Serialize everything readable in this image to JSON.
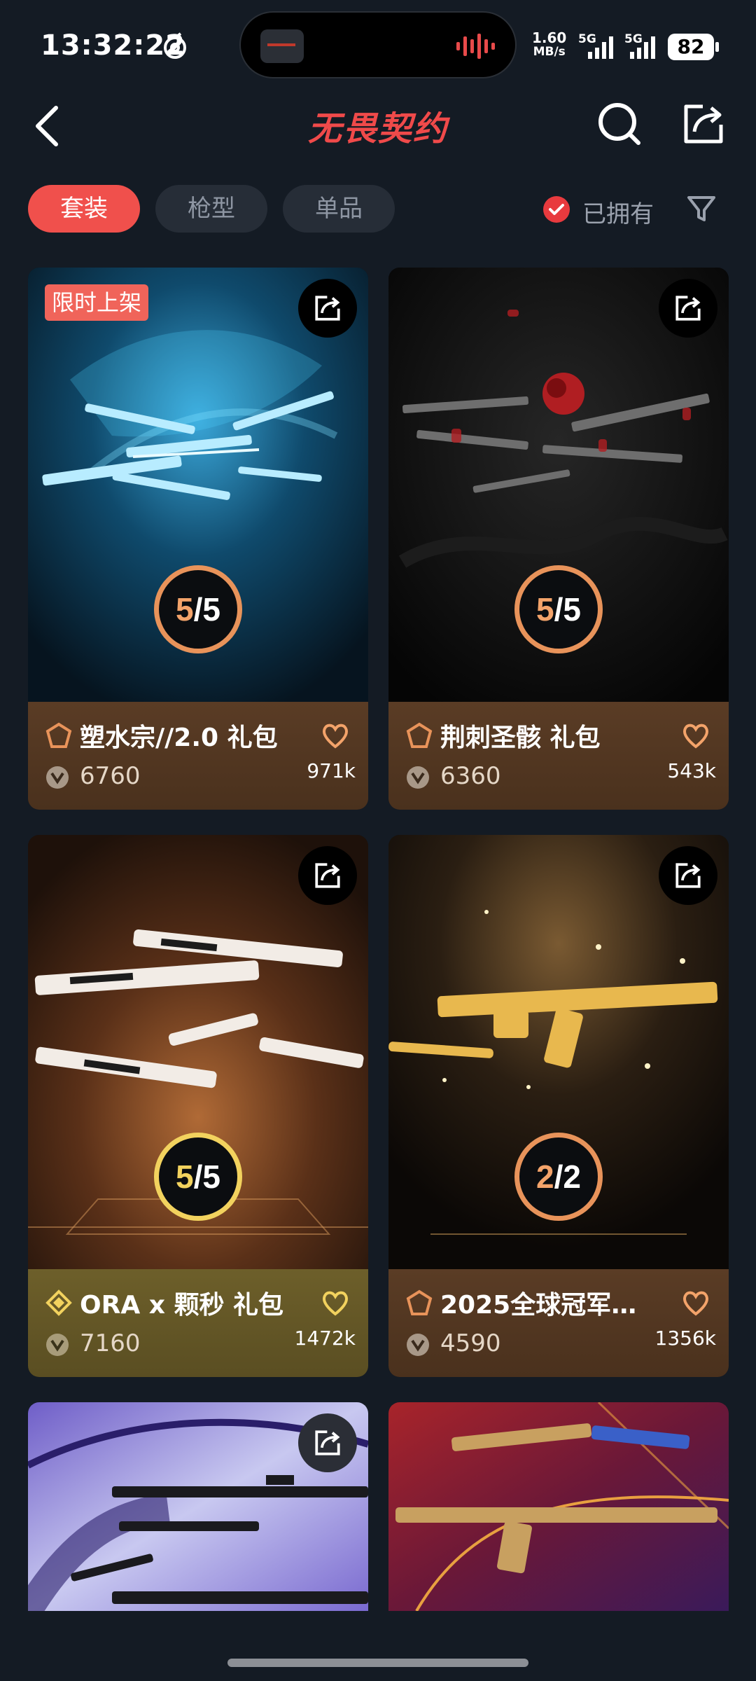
{
  "status_bar": {
    "time": "13:32:22",
    "net_speed_value": "1.60",
    "net_speed_unit": "MB/s",
    "sim1": "5G",
    "sim2": "5G",
    "battery": "82"
  },
  "header": {
    "title": "无畏契约",
    "back_icon": "chevron-left-icon",
    "search_icon": "search-icon",
    "share_icon": "share-icon"
  },
  "tabs": [
    {
      "label": "套装",
      "active": true
    },
    {
      "label": "枪型",
      "active": false
    },
    {
      "label": "单品",
      "active": false
    }
  ],
  "owned_filter": {
    "label": "已拥有",
    "checked": true
  },
  "filter_icon": "filter-icon",
  "colors": {
    "accent": "#f0504c",
    "background": "#141b24",
    "bronze_tier": "#5c3d26",
    "gold_tier": "#6d5f2a"
  },
  "cards": [
    {
      "name": "塑水宗//2.0 礼包",
      "price": "6760",
      "likes": "971k",
      "owned": "5",
      "total": "5",
      "badge": "限时上架",
      "tier": "bronze"
    },
    {
      "name": "荆刺圣骸 礼包",
      "price": "6360",
      "likes": "543k",
      "owned": "5",
      "total": "5",
      "badge": "",
      "tier": "bronze"
    },
    {
      "name": "ORA x 颗秒 礼包",
      "price": "7160",
      "likes": "1472k",
      "owned": "5",
      "total": "5",
      "badge": "",
      "tier": "gold"
    },
    {
      "name": "2025全球冠军…",
      "price": "4590",
      "likes": "1356k",
      "owned": "2",
      "total": "2",
      "badge": "",
      "tier": "bronze"
    }
  ]
}
